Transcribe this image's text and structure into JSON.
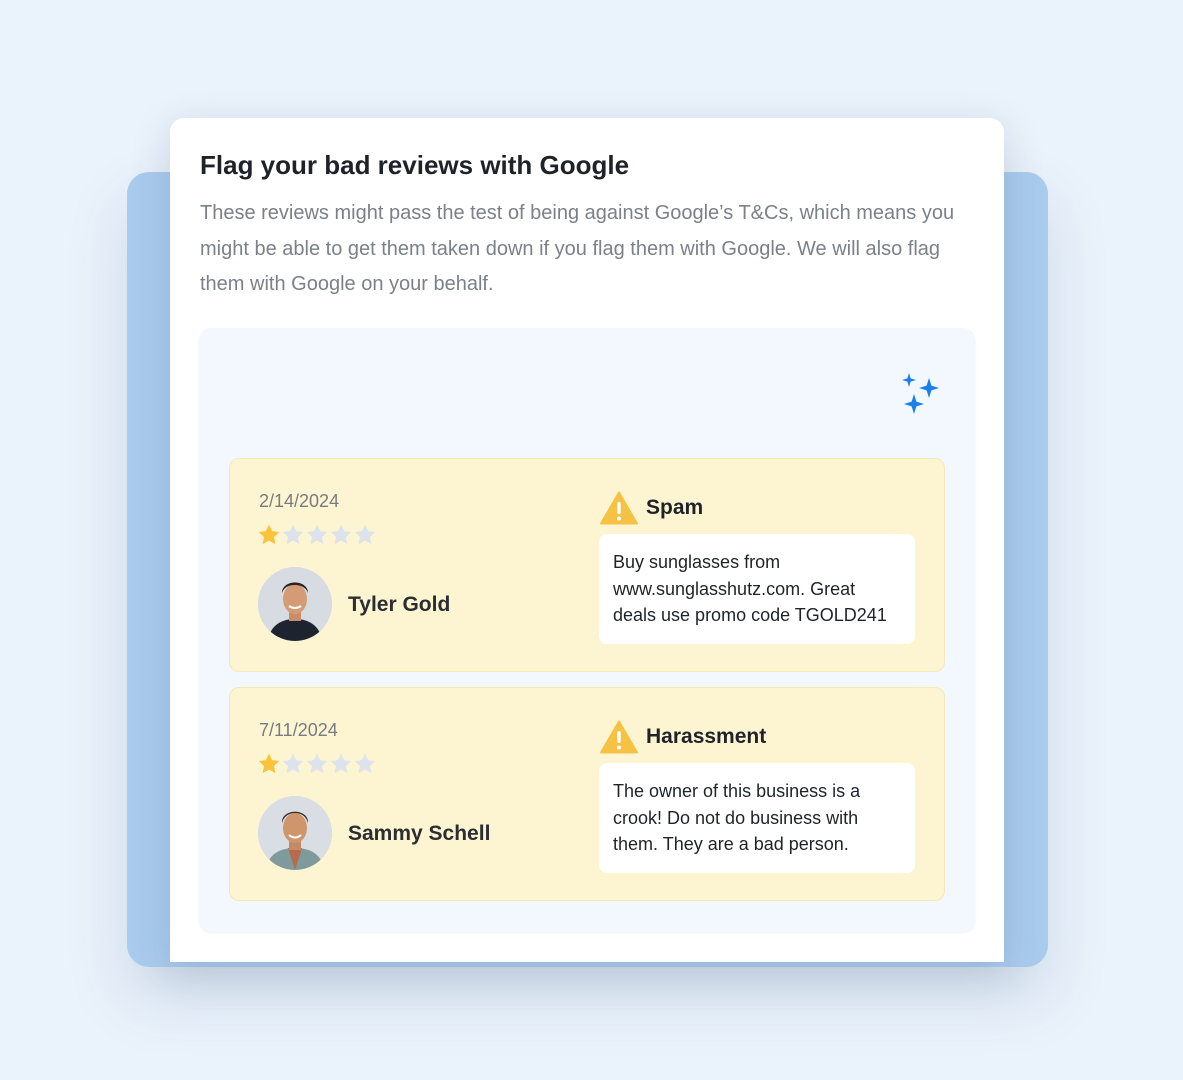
{
  "card": {
    "title": "Flag your bad reviews with Google",
    "description": "These reviews might pass the test of being against Google’s T&Cs, which means you might be able to get them taken down if you flag them with Google. We will also flag them with Google on your behalf."
  },
  "icons": {
    "sparkle": "sparkle-icon",
    "warning": "warning-icon",
    "star": "star-icon"
  },
  "colors": {
    "star_filled": "#f9c33a",
    "star_empty": "#dde3ec",
    "warning": "#f6c244",
    "sparkle": "#1a7fe8",
    "review_bg": "#fdf5d1"
  },
  "reviews": [
    {
      "date": "2/14/2024",
      "rating": 1,
      "max_rating": 5,
      "name": "Tyler Gold",
      "flag_type": "Spam",
      "text": "Buy sunglasses from www.sunglasshutz.com. Great deals use promo code TGOLD241"
    },
    {
      "date": "7/11/2024",
      "rating": 1,
      "max_rating": 5,
      "name": "Sammy Schell",
      "flag_type": "Harassment",
      "text": "The owner of this business is a crook! Do not do business with them. They are a bad person."
    }
  ]
}
